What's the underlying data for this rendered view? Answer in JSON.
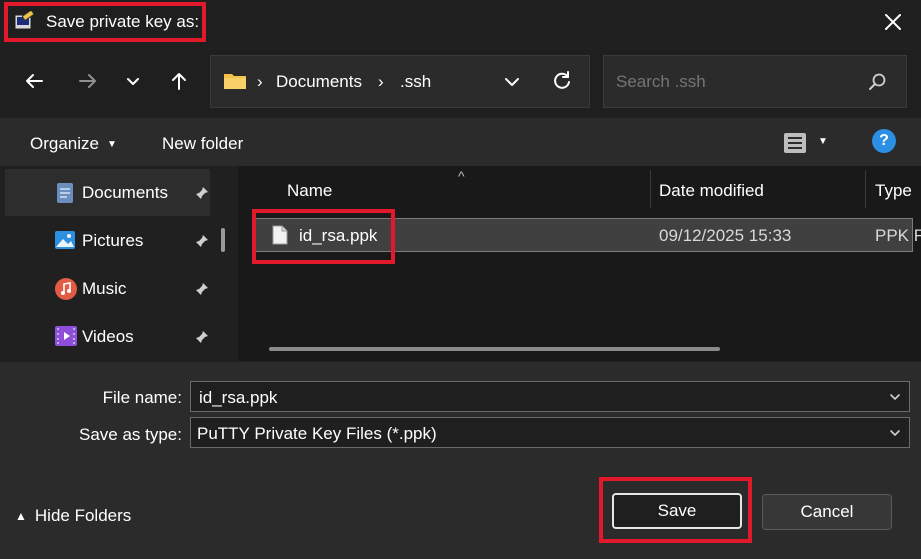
{
  "window": {
    "title": "Save private key as:",
    "close_icon": "close-icon"
  },
  "navigation": {
    "path": [
      "Documents",
      ".ssh"
    ],
    "search_placeholder": "Search .ssh"
  },
  "toolbar": {
    "organize_label": "Organize",
    "new_folder_label": "New folder"
  },
  "sidebar": {
    "items": [
      {
        "label": "Documents",
        "icon": "documents-icon",
        "pinned": true,
        "active": true
      },
      {
        "label": "Pictures",
        "icon": "pictures-icon",
        "pinned": true,
        "active": false
      },
      {
        "label": "Music",
        "icon": "music-icon",
        "pinned": true,
        "active": false
      },
      {
        "label": "Videos",
        "icon": "videos-icon",
        "pinned": true,
        "active": false
      }
    ]
  },
  "file_list": {
    "columns": [
      "Name",
      "Date modified",
      "Type"
    ],
    "rows": [
      {
        "name": "id_rsa.ppk",
        "date_modified": "09/12/2025 15:33",
        "type": "PPK F"
      }
    ]
  },
  "form": {
    "file_name_label": "File name:",
    "file_name_value": "id_rsa.ppk",
    "save_as_type_label": "Save as type:",
    "save_as_type_value": "PuTTY Private Key Files (*.ppk)"
  },
  "footer": {
    "hide_folders_label": "Hide Folders",
    "save_label": "Save",
    "cancel_label": "Cancel"
  }
}
